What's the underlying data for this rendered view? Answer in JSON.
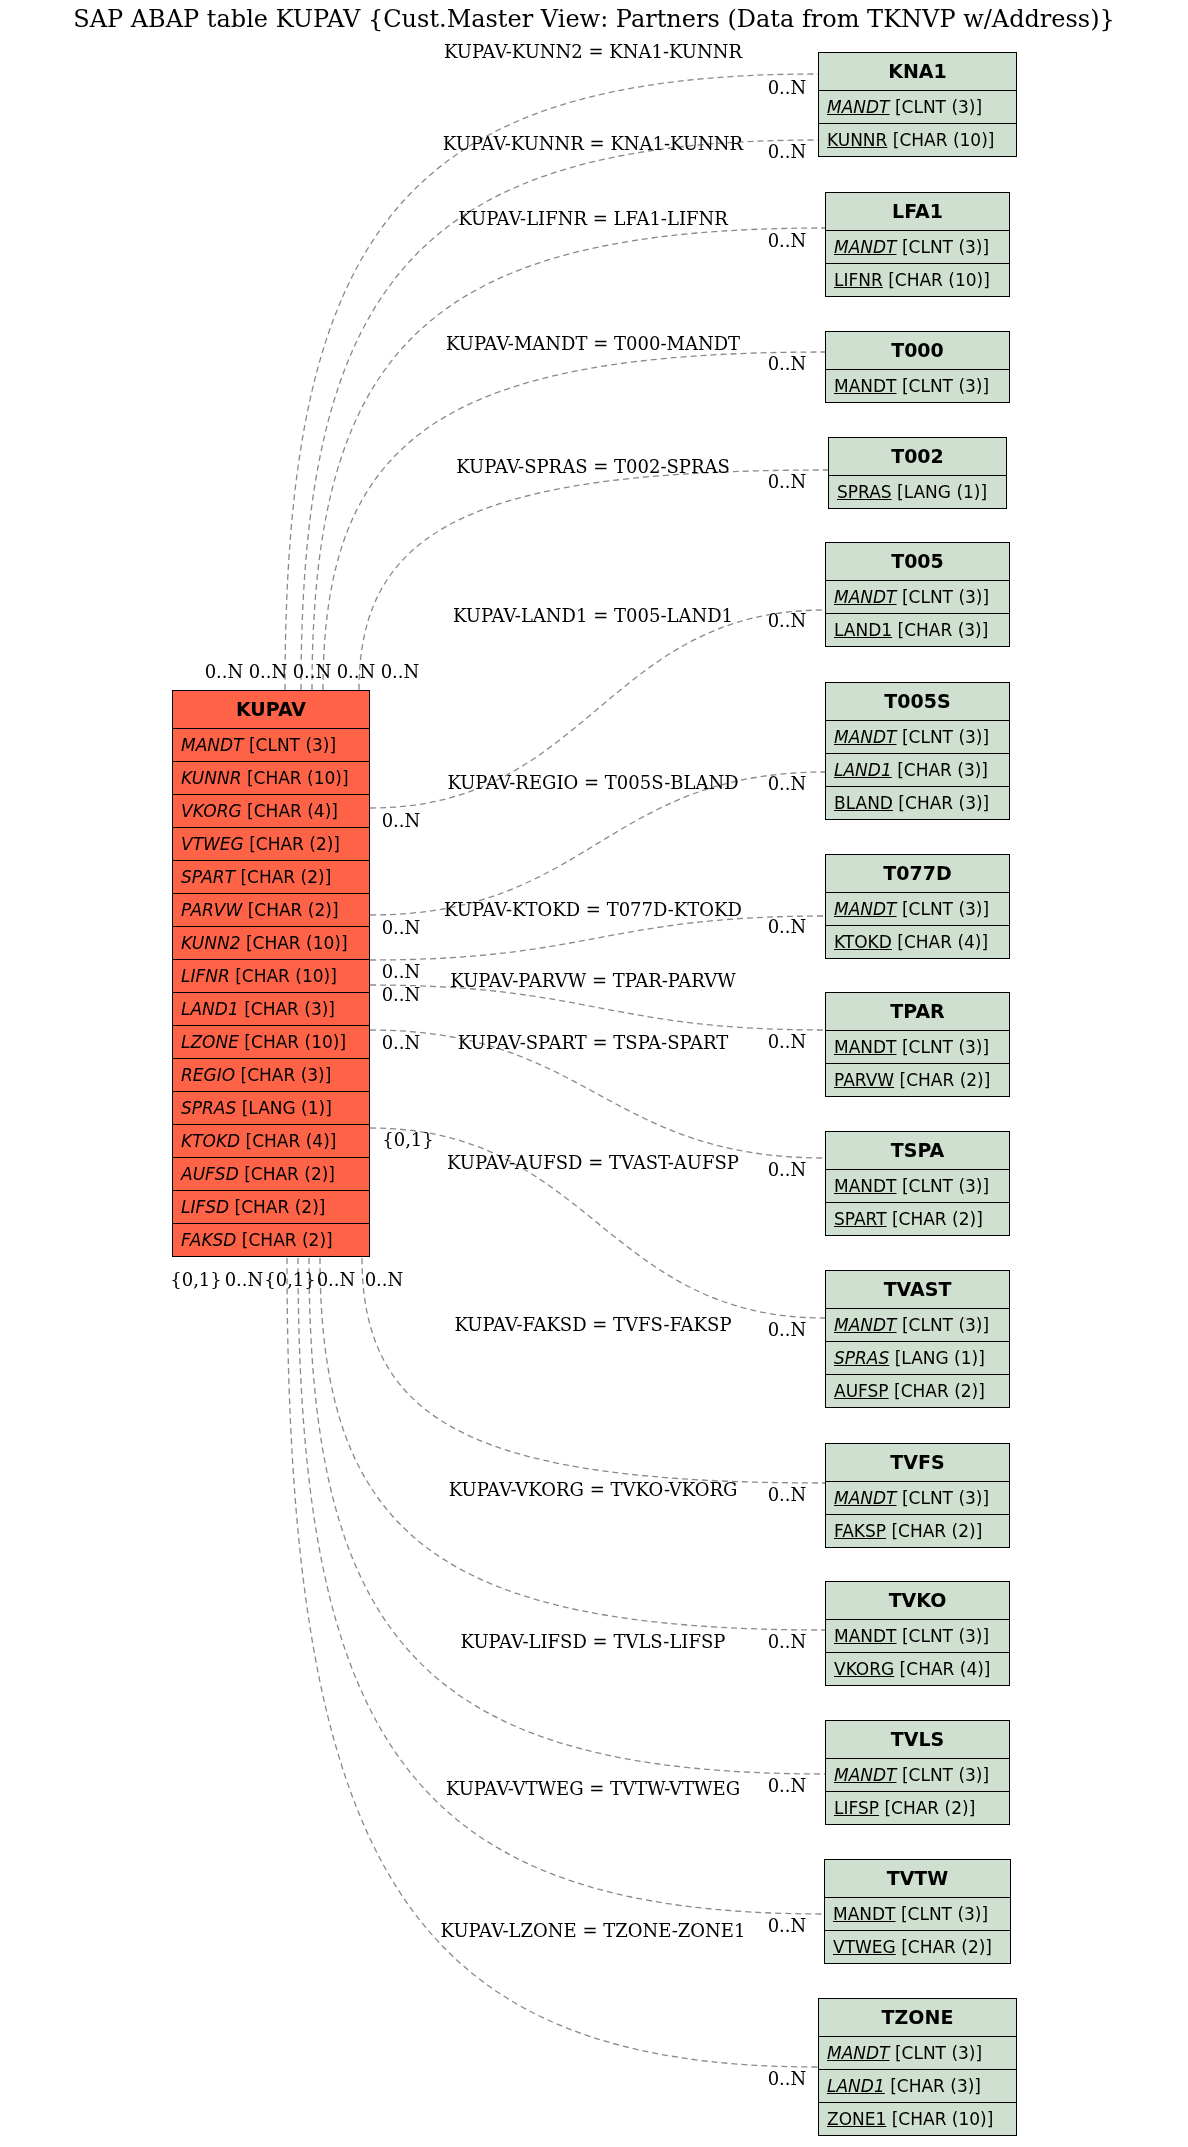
{
  "title": "SAP ABAP table KUPAV {Cust.Master View: Partners (Data from TKNVP w/Address)}",
  "tables": [
    {
      "name": "KUPAV",
      "kind": "main",
      "fields": [
        {
          "name": "MANDT",
          "type": "[CLNT (3)]",
          "key": false,
          "italic": true
        },
        {
          "name": "KUNNR",
          "type": "[CHAR (10)]",
          "key": false,
          "italic": true
        },
        {
          "name": "VKORG",
          "type": "[CHAR (4)]",
          "key": false,
          "italic": true
        },
        {
          "name": "VTWEG",
          "type": "[CHAR (2)]",
          "key": false,
          "italic": true
        },
        {
          "name": "SPART",
          "type": "[CHAR (2)]",
          "key": false,
          "italic": true
        },
        {
          "name": "PARVW",
          "type": "[CHAR (2)]",
          "key": false,
          "italic": true
        },
        {
          "name": "KUNN2",
          "type": "[CHAR (10)]",
          "key": false,
          "italic": true
        },
        {
          "name": "LIFNR",
          "type": "[CHAR (10)]",
          "key": false,
          "italic": true
        },
        {
          "name": "LAND1",
          "type": "[CHAR (3)]",
          "key": false,
          "italic": true
        },
        {
          "name": "LZONE",
          "type": "[CHAR (10)]",
          "key": false,
          "italic": true
        },
        {
          "name": "REGIO",
          "type": "[CHAR (3)]",
          "key": false,
          "italic": true
        },
        {
          "name": "SPRAS",
          "type": "[LANG (1)]",
          "key": false,
          "italic": true
        },
        {
          "name": "KTOKD",
          "type": "[CHAR (4)]",
          "key": false,
          "italic": true
        },
        {
          "name": "AUFSD",
          "type": "[CHAR (2)]",
          "key": false,
          "italic": true
        },
        {
          "name": "LIFSD",
          "type": "[CHAR (2)]",
          "key": false,
          "italic": true
        },
        {
          "name": "FAKSD",
          "type": "[CHAR (2)]",
          "key": false,
          "italic": true
        }
      ]
    },
    {
      "name": "KNA1",
      "kind": "related",
      "fields": [
        {
          "name": "MANDT",
          "type": "[CLNT (3)]",
          "key": true,
          "italic": true
        },
        {
          "name": "KUNNR",
          "type": "[CHAR (10)]",
          "key": true,
          "italic": false
        }
      ]
    },
    {
      "name": "LFA1",
      "kind": "related",
      "fields": [
        {
          "name": "MANDT",
          "type": "[CLNT (3)]",
          "key": true,
          "italic": true
        },
        {
          "name": "LIFNR",
          "type": "[CHAR (10)]",
          "key": true,
          "italic": false
        }
      ]
    },
    {
      "name": "T000",
      "kind": "related",
      "fields": [
        {
          "name": "MANDT",
          "type": "[CLNT (3)]",
          "key": true,
          "italic": false
        }
      ]
    },
    {
      "name": "T002",
      "kind": "related",
      "fields": [
        {
          "name": "SPRAS",
          "type": "[LANG (1)]",
          "key": true,
          "italic": false
        }
      ]
    },
    {
      "name": "T005",
      "kind": "related",
      "fields": [
        {
          "name": "MANDT",
          "type": "[CLNT (3)]",
          "key": true,
          "italic": true
        },
        {
          "name": "LAND1",
          "type": "[CHAR (3)]",
          "key": true,
          "italic": false
        }
      ]
    },
    {
      "name": "T005S",
      "kind": "related",
      "fields": [
        {
          "name": "MANDT",
          "type": "[CLNT (3)]",
          "key": true,
          "italic": true
        },
        {
          "name": "LAND1",
          "type": "[CHAR (3)]",
          "key": true,
          "italic": true
        },
        {
          "name": "BLAND",
          "type": "[CHAR (3)]",
          "key": true,
          "italic": false
        }
      ]
    },
    {
      "name": "T077D",
      "kind": "related",
      "fields": [
        {
          "name": "MANDT",
          "type": "[CLNT (3)]",
          "key": true,
          "italic": true
        },
        {
          "name": "KTOKD",
          "type": "[CHAR (4)]",
          "key": true,
          "italic": false
        }
      ]
    },
    {
      "name": "TPAR",
      "kind": "related",
      "fields": [
        {
          "name": "MANDT",
          "type": "[CLNT (3)]",
          "key": true,
          "italic": false
        },
        {
          "name": "PARVW",
          "type": "[CHAR (2)]",
          "key": true,
          "italic": false
        }
      ]
    },
    {
      "name": "TSPA",
      "kind": "related",
      "fields": [
        {
          "name": "MANDT",
          "type": "[CLNT (3)]",
          "key": true,
          "italic": false
        },
        {
          "name": "SPART",
          "type": "[CHAR (2)]",
          "key": true,
          "italic": false
        }
      ]
    },
    {
      "name": "TVAST",
      "kind": "related",
      "fields": [
        {
          "name": "MANDT",
          "type": "[CLNT (3)]",
          "key": true,
          "italic": true
        },
        {
          "name": "SPRAS",
          "type": "[LANG (1)]",
          "key": true,
          "italic": true
        },
        {
          "name": "AUFSP",
          "type": "[CHAR (2)]",
          "key": true,
          "italic": false
        }
      ]
    },
    {
      "name": "TVFS",
      "kind": "related",
      "fields": [
        {
          "name": "MANDT",
          "type": "[CLNT (3)]",
          "key": true,
          "italic": true
        },
        {
          "name": "FAKSP",
          "type": "[CHAR (2)]",
          "key": true,
          "italic": false
        }
      ]
    },
    {
      "name": "TVKO",
      "kind": "related",
      "fields": [
        {
          "name": "MANDT",
          "type": "[CLNT (3)]",
          "key": true,
          "italic": false
        },
        {
          "name": "VKORG",
          "type": "[CHAR (4)]",
          "key": true,
          "italic": false
        }
      ]
    },
    {
      "name": "TVLS",
      "kind": "related",
      "fields": [
        {
          "name": "MANDT",
          "type": "[CLNT (3)]",
          "key": true,
          "italic": true
        },
        {
          "name": "LIFSP",
          "type": "[CHAR (2)]",
          "key": true,
          "italic": false
        }
      ]
    },
    {
      "name": "TVTW",
      "kind": "related",
      "fields": [
        {
          "name": "MANDT",
          "type": "[CLNT (3)]",
          "key": true,
          "italic": false
        },
        {
          "name": "VTWEG",
          "type": "[CHAR (2)]",
          "key": true,
          "italic": false
        }
      ]
    },
    {
      "name": "TZONE",
      "kind": "related",
      "fields": [
        {
          "name": "MANDT",
          "type": "[CLNT (3)]",
          "key": true,
          "italic": true
        },
        {
          "name": "LAND1",
          "type": "[CHAR (3)]",
          "key": true,
          "italic": true
        },
        {
          "name": "ZONE1",
          "type": "[CHAR (10)]",
          "key": true,
          "italic": false
        }
      ]
    }
  ],
  "relations": [
    {
      "label": "KUPAV-KUNN2 = KNA1-KUNNR",
      "source_cardinality": "0..N",
      "target_cardinality": "0..N"
    },
    {
      "label": "KUPAV-KUNNR = KNA1-KUNNR",
      "source_cardinality": "0..N",
      "target_cardinality": "0..N"
    },
    {
      "label": "KUPAV-LIFNR = LFA1-LIFNR",
      "source_cardinality": "0..N",
      "target_cardinality": "0..N"
    },
    {
      "label": "KUPAV-MANDT = T000-MANDT",
      "source_cardinality": "0..N",
      "target_cardinality": "0..N"
    },
    {
      "label": "KUPAV-SPRAS = T002-SPRAS",
      "source_cardinality": "0..N",
      "target_cardinality": "0..N"
    },
    {
      "label": "KUPAV-LAND1 = T005-LAND1",
      "source_cardinality": "0..N",
      "target_cardinality": "0..N"
    },
    {
      "label": "KUPAV-REGIO = T005S-BLAND",
      "source_cardinality": "0..N",
      "target_cardinality": "0..N"
    },
    {
      "label": "KUPAV-KTOKD = T077D-KTOKD",
      "source_cardinality": "0..N",
      "target_cardinality": "0..N"
    },
    {
      "label": "KUPAV-PARVW = TPAR-PARVW",
      "source_cardinality": "0..N",
      "target_cardinality": "0..N"
    },
    {
      "label": "KUPAV-SPART = TSPA-SPART",
      "source_cardinality": "0..N",
      "target_cardinality": "0..N"
    },
    {
      "label": "KUPAV-AUFSD = TVAST-AUFSP",
      "source_cardinality": "{0,1}",
      "target_cardinality": "0..N"
    },
    {
      "label": "KUPAV-FAKSD = TVFS-FAKSP",
      "source_cardinality": "{0,1}",
      "target_cardinality": "0..N"
    },
    {
      "label": "KUPAV-VKORG = TVKO-VKORG",
      "source_cardinality": "0..N",
      "target_cardinality": "0..N"
    },
    {
      "label": "KUPAV-LIFSD = TVLS-LIFSP",
      "source_cardinality": "{0,1}",
      "target_cardinality": "0..N"
    },
    {
      "label": "KUPAV-VTWEG = TVTW-VTWEG",
      "source_cardinality": "0..N",
      "target_cardinality": "0..N"
    },
    {
      "label": "KUPAV-LZONE = TZONE-ZONE1",
      "source_cardinality": "0..N",
      "target_cardinality": "0..N"
    }
  ]
}
